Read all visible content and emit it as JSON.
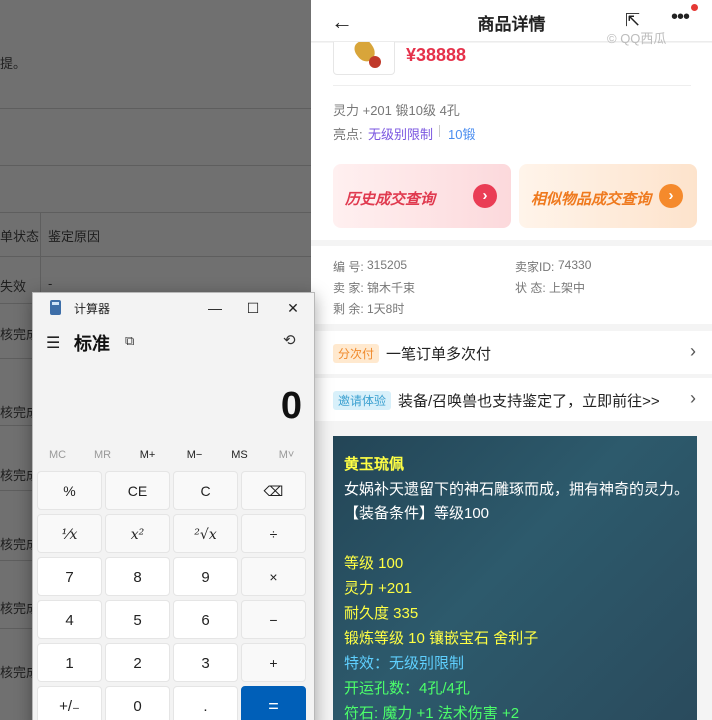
{
  "background_page": {
    "hint_text": "提。",
    "col_state": "单状态",
    "col_reason": "鉴定原因",
    "row_first": "失效",
    "row_dash": "-",
    "row_status": "核完成"
  },
  "product_page": {
    "title": "商品详情",
    "back_icon": "back-arrow-icon",
    "share_icon": "share-icon",
    "more_icon": "more-dots-icon",
    "watermark": "© QQ西瓜",
    "price": "¥38888",
    "attributes": "灵力 +201 锻10级 4孔",
    "highlights_label": "亮点:",
    "highlight_1": "无级别限制",
    "highlight_2": "10锻",
    "query_history": "历史成交查询",
    "query_similar": "相似物品成交查询",
    "info": {
      "id_label": "编 号:",
      "id_value": "315205",
      "seller_id_label": "卖家ID:",
      "seller_id_value": "74330",
      "seller_label": "卖 家:",
      "seller_value": "锦木千束",
      "status_label": "状 态:",
      "status_value": "上架中",
      "remain_label": "剩 余:",
      "remain_value": "1天8时"
    },
    "installment_tag": "分次付",
    "installment_text": "一笔订单多次付",
    "invite_tag": "邀请体验",
    "invite_text": "装备/召唤兽也支持鉴定了，立即前往>>",
    "description": {
      "name": "黄玉琉佩",
      "lore": "女娲补天遗留下的神石雕琢而成，拥有神奇的灵力。",
      "requirement": "【装备条件】等级100",
      "level": "等级 100",
      "spirit": "灵力 +201",
      "durability": "耐久度 335",
      "forge": "锻炼等级 10 镶嵌宝石 舍利子",
      "special": "特效：无级别限制",
      "holes": "开运孔数：4孔/4孔",
      "rune": "符石: 魔力 +1 法术伤害 +2"
    }
  },
  "calculator": {
    "window_title": "计算器",
    "minimize": "—",
    "maximize": "☐",
    "close": "✕",
    "menu_icon": "☰",
    "mode": "标准",
    "keep_on_top_icon": "⧉",
    "history_icon": "⟲",
    "display": "0",
    "memory": [
      "MC",
      "MR",
      "M+",
      "M−",
      "MS",
      "M˅"
    ],
    "keys": {
      "percent": "%",
      "ce": "CE",
      "c": "C",
      "backspace": "⌫",
      "reciprocal": "⅟x",
      "square": "x²",
      "sqrt": "²√x",
      "divide": "÷",
      "seven": "7",
      "eight": "8",
      "nine": "9",
      "multiply": "×",
      "four": "4",
      "five": "5",
      "six": "6",
      "minus": "−",
      "one": "1",
      "two": "2",
      "three": "3",
      "plus": "+",
      "negate": "+/₋",
      "zero": "0",
      "decimal": ".",
      "equals": "="
    }
  }
}
